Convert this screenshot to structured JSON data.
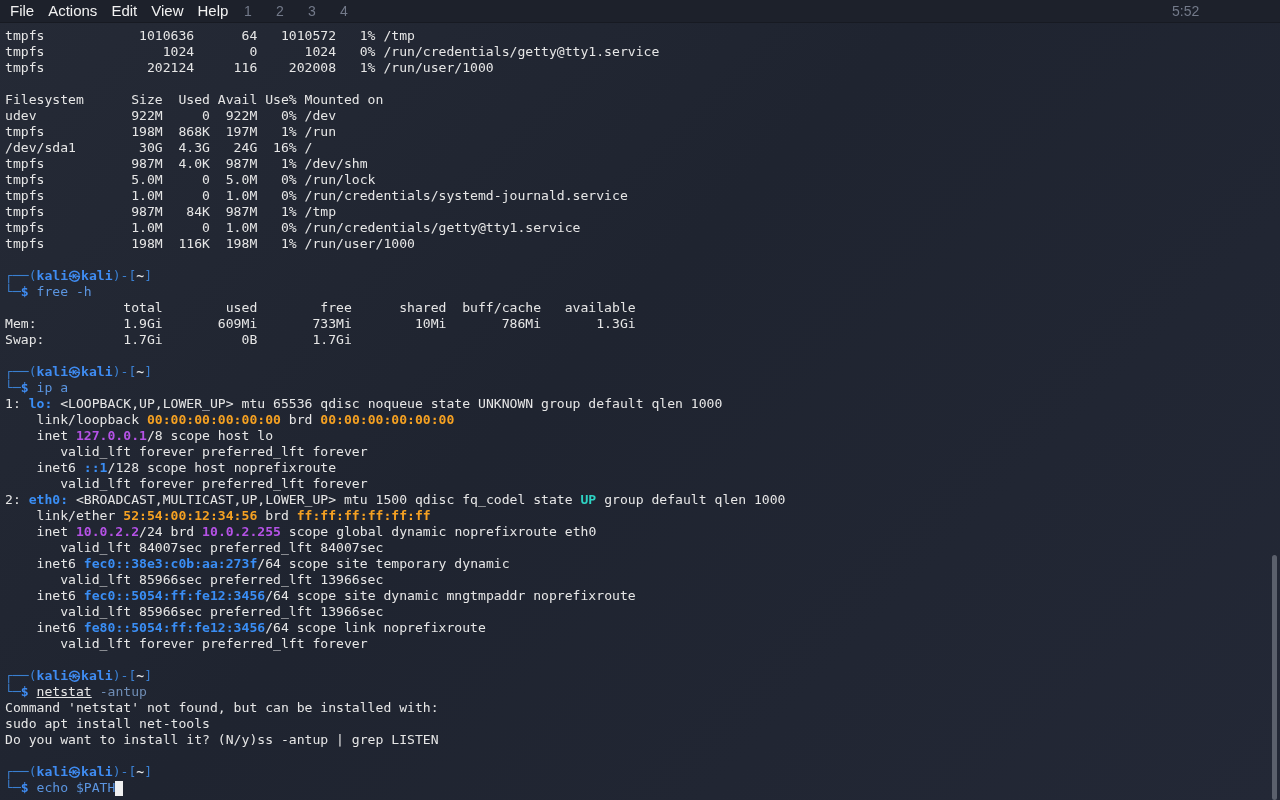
{
  "menu": [
    {
      "label": "File"
    },
    {
      "label": "Actions"
    },
    {
      "label": "Edit"
    },
    {
      "label": "View"
    },
    {
      "label": "Help"
    }
  ],
  "panel": {
    "workspaces": [
      "1",
      "2",
      "3",
      "4"
    ],
    "clock": "5:52"
  },
  "lines": [
    {
      "kind": "plain",
      "text": "tmpfs            1010636      64   1010572   1% /tmp"
    },
    {
      "kind": "plain",
      "text": "tmpfs               1024       0      1024   0% /run/credentials/getty@tty1.service"
    },
    {
      "kind": "plain",
      "text": "tmpfs             202124     116    202008   1% /run/user/1000"
    },
    {
      "kind": "blank"
    },
    {
      "kind": "plain",
      "text": "Filesystem      Size  Used Avail Use% Mounted on"
    },
    {
      "kind": "plain",
      "text": "udev            922M     0  922M   0% /dev"
    },
    {
      "kind": "plain",
      "text": "tmpfs           198M  868K  197M   1% /run"
    },
    {
      "kind": "plain",
      "text": "/dev/sda1        30G  4.3G   24G  16% /"
    },
    {
      "kind": "plain",
      "text": "tmpfs           987M  4.0K  987M   1% /dev/shm"
    },
    {
      "kind": "plain",
      "text": "tmpfs           5.0M     0  5.0M   0% /run/lock"
    },
    {
      "kind": "plain",
      "text": "tmpfs           1.0M     0  1.0M   0% /run/credentials/systemd-journald.service"
    },
    {
      "kind": "plain",
      "text": "tmpfs           987M   84K  987M   1% /tmp"
    },
    {
      "kind": "plain",
      "text": "tmpfs           1.0M     0  1.0M   0% /run/credentials/getty@tty1.service"
    },
    {
      "kind": "plain",
      "text": "tmpfs           198M  116K  198M   1% /run/user/1000"
    },
    {
      "kind": "blank"
    },
    {
      "kind": "rich",
      "segs": [
        {
          "t": "┌──(",
          "kind": "frame"
        },
        {
          "t": "kali㉿kali",
          "kind": "user"
        },
        {
          "t": ")-[",
          "kind": "frame"
        },
        {
          "t": "~",
          "kind": "dir"
        },
        {
          "t": "]",
          "kind": "frame"
        }
      ]
    },
    {
      "kind": "rich",
      "segs": [
        {
          "t": "└─",
          "kind": "frame"
        },
        {
          "t": "$",
          "kind": "dollar"
        },
        {
          "t": " free -h",
          "kind": "cmd"
        }
      ]
    },
    {
      "kind": "plain",
      "text": "               total        used        free      shared  buff/cache   available"
    },
    {
      "kind": "plain",
      "text": "Mem:           1.9Gi       609Mi       733Mi        10Mi       786Mi       1.3Gi"
    },
    {
      "kind": "plain",
      "text": "Swap:          1.7Gi          0B       1.7Gi"
    },
    {
      "kind": "blank"
    },
    {
      "kind": "rich",
      "segs": [
        {
          "t": "┌──(",
          "kind": "frame"
        },
        {
          "t": "kali㉿kali",
          "kind": "user"
        },
        {
          "t": ")-[",
          "kind": "frame"
        },
        {
          "t": "~",
          "kind": "dir"
        },
        {
          "t": "]",
          "kind": "frame"
        }
      ]
    },
    {
      "kind": "rich",
      "segs": [
        {
          "t": "└─",
          "kind": "frame"
        },
        {
          "t": "$",
          "kind": "dollar"
        },
        {
          "t": " ip a",
          "kind": "cmd"
        }
      ]
    },
    {
      "kind": "rich",
      "segs": [
        {
          "t": "1: ",
          "kind": "plain"
        },
        {
          "t": "lo:",
          "kind": "blue"
        },
        {
          "t": " <LOOPBACK,UP,LOWER_UP> mtu 65536 qdisc noqueue state UNKNOWN group default qlen 1000",
          "kind": "plain"
        }
      ]
    },
    {
      "kind": "rich",
      "segs": [
        {
          "t": "    link/loopback ",
          "kind": "plain"
        },
        {
          "t": "00:00:00:00:00:00",
          "kind": "orange"
        },
        {
          "t": " brd ",
          "kind": "plain"
        },
        {
          "t": "00:00:00:00:00:00",
          "kind": "orange"
        }
      ]
    },
    {
      "kind": "rich",
      "segs": [
        {
          "t": "    inet ",
          "kind": "plain"
        },
        {
          "t": "127.0.0.1",
          "kind": "purple"
        },
        {
          "t": "/8 scope host lo",
          "kind": "plain"
        }
      ]
    },
    {
      "kind": "plain",
      "text": "       valid_lft forever preferred_lft forever"
    },
    {
      "kind": "rich",
      "segs": [
        {
          "t": "    inet6 ",
          "kind": "plain"
        },
        {
          "t": "::1",
          "kind": "blue"
        },
        {
          "t": "/128 scope host noprefixroute",
          "kind": "plain"
        }
      ]
    },
    {
      "kind": "plain",
      "text": "       valid_lft forever preferred_lft forever"
    },
    {
      "kind": "rich",
      "segs": [
        {
          "t": "2: ",
          "kind": "plain"
        },
        {
          "t": "eth0:",
          "kind": "blue"
        },
        {
          "t": " <BROADCAST,MULTICAST,UP,LOWER_UP> mtu 1500 qdisc fq_codel state ",
          "kind": "plain"
        },
        {
          "t": "UP",
          "kind": "cyan"
        },
        {
          "t": " group default qlen 1000",
          "kind": "plain"
        }
      ]
    },
    {
      "kind": "rich",
      "segs": [
        {
          "t": "    link/ether ",
          "kind": "plain"
        },
        {
          "t": "52:54:00:12:34:56",
          "kind": "orange"
        },
        {
          "t": " brd ",
          "kind": "plain"
        },
        {
          "t": "ff:ff:ff:ff:ff:ff",
          "kind": "orange"
        }
      ]
    },
    {
      "kind": "rich",
      "segs": [
        {
          "t": "    inet ",
          "kind": "plain"
        },
        {
          "t": "10.0.2.2",
          "kind": "purple"
        },
        {
          "t": "/24 brd ",
          "kind": "plain"
        },
        {
          "t": "10.0.2.255",
          "kind": "purple"
        },
        {
          "t": " scope global dynamic noprefixroute eth0",
          "kind": "plain"
        }
      ]
    },
    {
      "kind": "plain",
      "text": "       valid_lft 84007sec preferred_lft 84007sec"
    },
    {
      "kind": "rich",
      "segs": [
        {
          "t": "    inet6 ",
          "kind": "plain"
        },
        {
          "t": "fec0::38e3:c0b:aa:273f",
          "kind": "blue"
        },
        {
          "t": "/64 scope site temporary dynamic",
          "kind": "plain"
        }
      ]
    },
    {
      "kind": "plain",
      "text": "       valid_lft 85966sec preferred_lft 13966sec"
    },
    {
      "kind": "rich",
      "segs": [
        {
          "t": "    inet6 ",
          "kind": "plain"
        },
        {
          "t": "fec0::5054:ff:fe12:3456",
          "kind": "blue"
        },
        {
          "t": "/64 scope site dynamic mngtmpaddr noprefixroute",
          "kind": "plain"
        }
      ]
    },
    {
      "kind": "plain",
      "text": "       valid_lft 85966sec preferred_lft 13966sec"
    },
    {
      "kind": "rich",
      "segs": [
        {
          "t": "    inet6 ",
          "kind": "plain"
        },
        {
          "t": "fe80::5054:ff:fe12:3456",
          "kind": "blue"
        },
        {
          "t": "/64 scope link noprefixroute",
          "kind": "plain"
        }
      ]
    },
    {
      "kind": "plain",
      "text": "       valid_lft forever preferred_lft forever"
    },
    {
      "kind": "blank"
    },
    {
      "kind": "rich",
      "segs": [
        {
          "t": "┌──(",
          "kind": "frame"
        },
        {
          "t": "kali㉿kali",
          "kind": "user"
        },
        {
          "t": ")-[",
          "kind": "frame"
        },
        {
          "t": "~",
          "kind": "dir"
        },
        {
          "t": "]",
          "kind": "frame"
        }
      ]
    },
    {
      "kind": "rich",
      "segs": [
        {
          "t": "└─",
          "kind": "frame"
        },
        {
          "t": "$ ",
          "kind": "dollar"
        },
        {
          "t": "netstat",
          "kind": "cmdu"
        },
        {
          "t": " -antup",
          "kind": "arg"
        }
      ]
    },
    {
      "kind": "plain",
      "text": "Command 'netstat' not found, but can be installed with:"
    },
    {
      "kind": "plain",
      "text": "sudo apt install net-tools"
    },
    {
      "kind": "plain",
      "text": "Do you want to install it? (N/y)ss -antup | grep LISTEN"
    },
    {
      "kind": "blank"
    },
    {
      "kind": "rich",
      "segs": [
        {
          "t": "┌──(",
          "kind": "frame"
        },
        {
          "t": "kali㉿kali",
          "kind": "user"
        },
        {
          "t": ")-[",
          "kind": "frame"
        },
        {
          "t": "~",
          "kind": "dir"
        },
        {
          "t": "]",
          "kind": "frame"
        }
      ]
    },
    {
      "kind": "rich",
      "cursor": true,
      "segs": [
        {
          "t": "└─",
          "kind": "frame"
        },
        {
          "t": "$",
          "kind": "dollar"
        },
        {
          "t": " echo $PATH",
          "kind": "cmd"
        }
      ]
    }
  ]
}
